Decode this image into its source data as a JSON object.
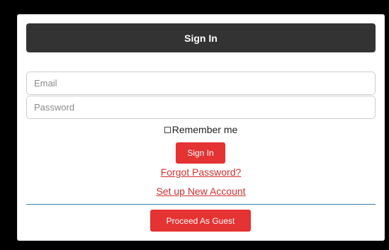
{
  "header": {
    "title": "Sign In"
  },
  "form": {
    "email_placeholder": "Email",
    "password_placeholder": "Password",
    "remember_label": "Remember me",
    "signin_label": "Sign In",
    "forgot_label": "Forgot Password?",
    "setup_label": "Set up New Account",
    "guest_label": "Proceed As Guest"
  },
  "colors": {
    "header_bg": "#333333",
    "button_bg": "#e53232",
    "link": "#d32f2f",
    "divider": "#3a7fb5"
  }
}
